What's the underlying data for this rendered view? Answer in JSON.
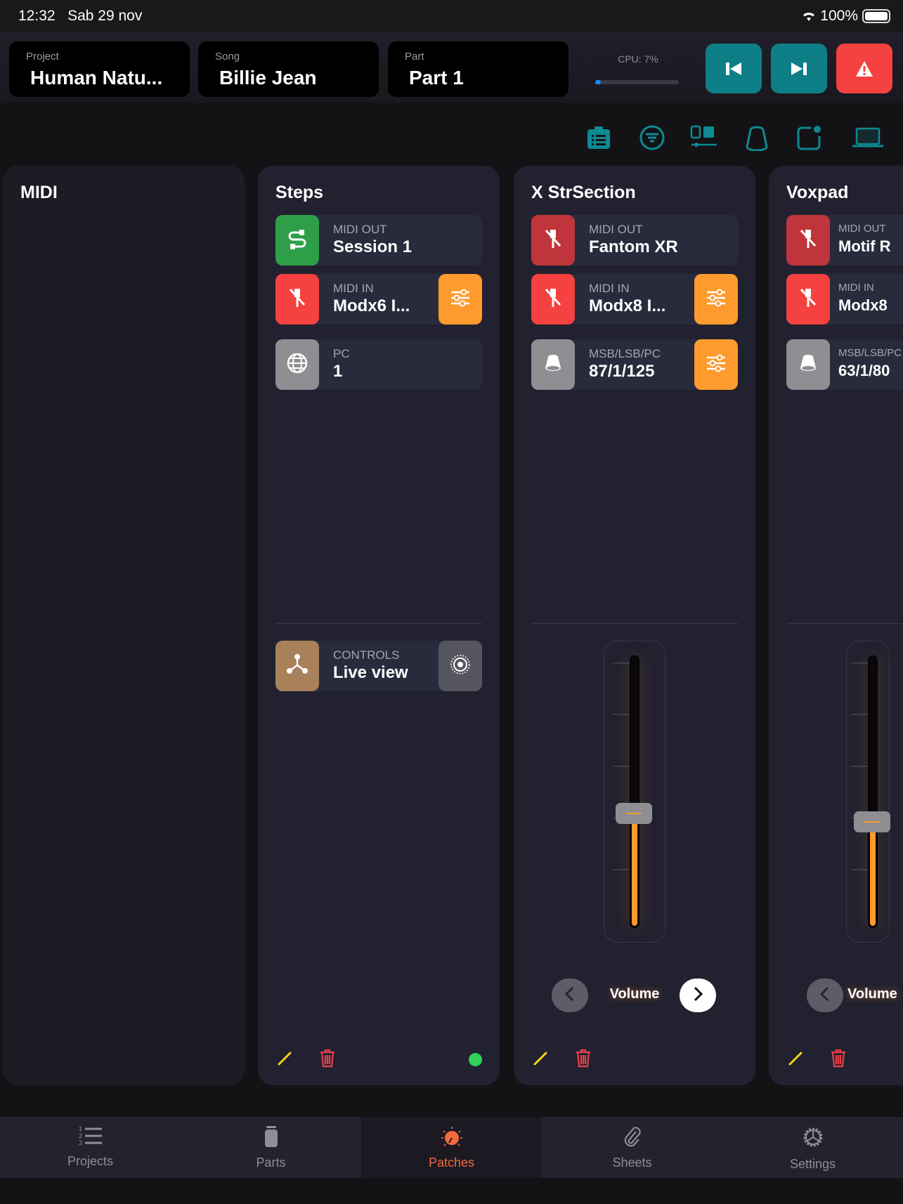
{
  "status_bar": {
    "time": "12:32",
    "date": "Sab 29 nov",
    "battery": "100%"
  },
  "header": {
    "project": {
      "label": "Project",
      "value": "Human Natu..."
    },
    "song": {
      "label": "Song",
      "value": "Billie Jean"
    },
    "part": {
      "label": "Part",
      "value": "Part 1"
    },
    "cpu": {
      "label": "CPU: 7%",
      "percent": 7
    }
  },
  "colors": {
    "teal": "#0f7f87",
    "alert": "#f5413f",
    "orange": "#ff9a2e",
    "green": "#2f9e48"
  },
  "toolbar_icons": [
    "clipboard-icon",
    "filter-icon",
    "layout-icon",
    "knob-icon",
    "notification-square-icon",
    "laptop-icon"
  ],
  "columns": [
    {
      "title": "MIDI",
      "empty": true
    },
    {
      "title": "Steps",
      "rows": [
        {
          "icon": "cable-icon",
          "color": "#2f9e48",
          "label": "MIDI OUT",
          "value": "Session 1"
        },
        {
          "icon": "disconnected-icon",
          "color": "#f5413f",
          "label": "MIDI IN",
          "value": "Modx6 I...",
          "settings": true
        },
        {
          "icon": "globe-icon",
          "color": "#8e8e93",
          "label": "PC",
          "value": "1"
        }
      ],
      "controls": {
        "icon": "hub-icon",
        "color": "#a8805a",
        "label": "CONTROLS",
        "value": "Live view"
      },
      "active": true
    },
    {
      "title": "X StrSection",
      "rows": [
        {
          "icon": "disconnected-icon",
          "color": "#c0353b",
          "label": "MIDI OUT",
          "value": "Fantom XR"
        },
        {
          "icon": "disconnected-icon",
          "color": "#f5413f",
          "label": "MIDI IN",
          "value": "Modx8 I...",
          "settings": true
        },
        {
          "icon": "knob-icon",
          "color": "#8e8e93",
          "label": "MSB/LSB/PC",
          "value": "87/1/125",
          "settings": true
        }
      ],
      "fader": {
        "label": "Volume",
        "level": 0.42
      }
    },
    {
      "title": "Voxpad",
      "rows": [
        {
          "icon": "disconnected-icon",
          "color": "#c0353b",
          "label": "MIDI OUT",
          "value": "Motif R"
        },
        {
          "icon": "disconnected-icon",
          "color": "#f5413f",
          "label": "MIDI IN",
          "value": "Modx8"
        },
        {
          "icon": "knob-icon",
          "color": "#8e8e93",
          "label": "MSB/LSB/PC",
          "value": "63/1/80"
        }
      ],
      "fader": {
        "label": "Volume",
        "level": 0.39
      }
    }
  ],
  "tabs": [
    {
      "label": "Projects",
      "icon": "numbered-list-icon"
    },
    {
      "label": "Parts",
      "icon": "parts-icon"
    },
    {
      "label": "Patches",
      "icon": "patch-knob-icon",
      "selected": true
    },
    {
      "label": "Sheets",
      "icon": "paperclip-icon"
    },
    {
      "label": "Settings",
      "icon": "gear-icon"
    }
  ]
}
